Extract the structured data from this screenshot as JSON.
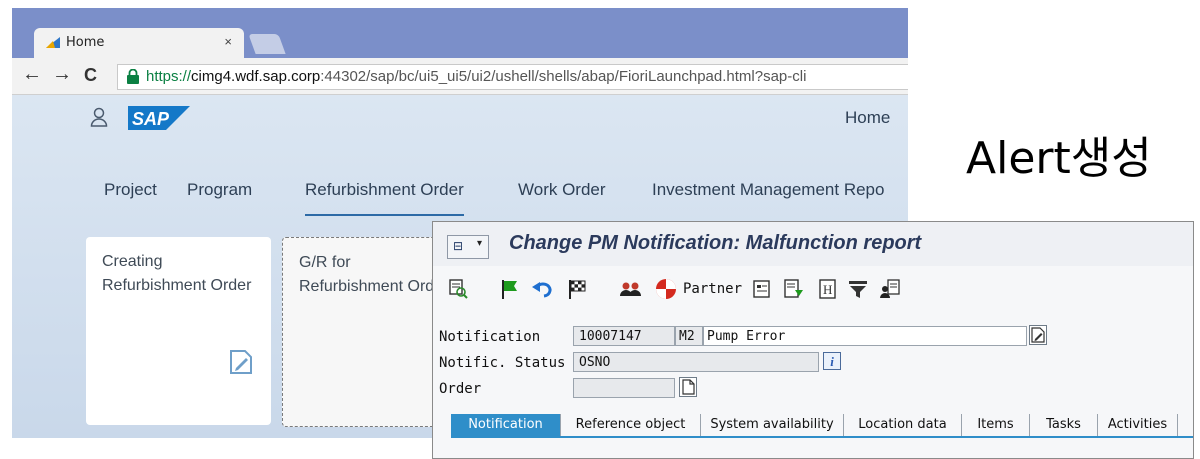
{
  "browser": {
    "tab_title": "Home",
    "tab_close": "×",
    "nav": {
      "back": "←",
      "forward": "→",
      "reload": "C"
    },
    "url": {
      "scheme": "https://",
      "host": "cimg4.wdf.sap.corp",
      "rest": ":44302/sap/bc/ui5_ui5/ui2/ushell/shells/abap/FioriLaunchpad.html?sap-cli"
    }
  },
  "fiori": {
    "logo": "SAP",
    "home_label": "Home",
    "tabs": [
      "Project",
      "Program",
      "Refurbishment Order",
      "Work Order",
      "Investment Management Repo"
    ],
    "selected_tab": "Refurbishment Order",
    "tiles": [
      {
        "title": "Creating Refurbishment Order"
      },
      {
        "title": "G/R for Refurbishment Order"
      }
    ]
  },
  "annotation": "Alert생성",
  "sapgui": {
    "title": "Change PM Notification: Malfunction report",
    "partner_label": "Partner",
    "fields": {
      "notification": {
        "label": "Notification",
        "number": "10007147",
        "type": "M2",
        "text": "Pump Error"
      },
      "status": {
        "label": "Notific. Status",
        "value": "OSNO",
        "info": "i"
      },
      "order": {
        "label": "Order",
        "value": ""
      }
    },
    "tabs": [
      "Notification",
      "Reference object",
      "System availability",
      "Location data",
      "Items",
      "Tasks",
      "Activities"
    ],
    "active_tab": "Notification",
    "icons": [
      "select-icon",
      "flag-icon",
      "undo-icon",
      "checkered-flag-icon",
      "persons-icon",
      "partner-icon",
      "document-icon",
      "document-edit-icon",
      "header-icon",
      "filter-icon",
      "person-document-icon"
    ]
  },
  "colors": {
    "accent": "#2f8ec9",
    "title_blue": "#2b3a5c",
    "tab_strip": "#7b8fc9",
    "sap_blue": "#1478c8"
  }
}
